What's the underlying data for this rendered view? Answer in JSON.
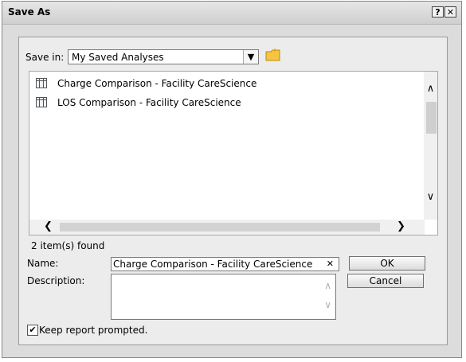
{
  "window": {
    "title": "Save As",
    "help_button": "?",
    "close_button": "✕"
  },
  "save_in": {
    "label": "Save in:",
    "value": "My Saved Analyses"
  },
  "files": [
    {
      "label": "Charge Comparison - Facility CareScience",
      "icon": "report-grid-icon"
    },
    {
      "label": "LOS Comparison - Facility CareScience",
      "icon": "report-grid-icon"
    }
  ],
  "count_text": "2 item(s) found",
  "name": {
    "label": "Name:",
    "value": "Charge Comparison - Facility CareScience"
  },
  "description": {
    "label": "Description:",
    "value": ""
  },
  "buttons": {
    "ok": "OK",
    "cancel": "Cancel"
  },
  "keep_prompted": {
    "label": "Keep report prompted.",
    "checked": true
  },
  "colors": {
    "window_bg": "#dcdcdc",
    "panel_bg": "#ececec",
    "folder_yellow": "#f5c542"
  }
}
